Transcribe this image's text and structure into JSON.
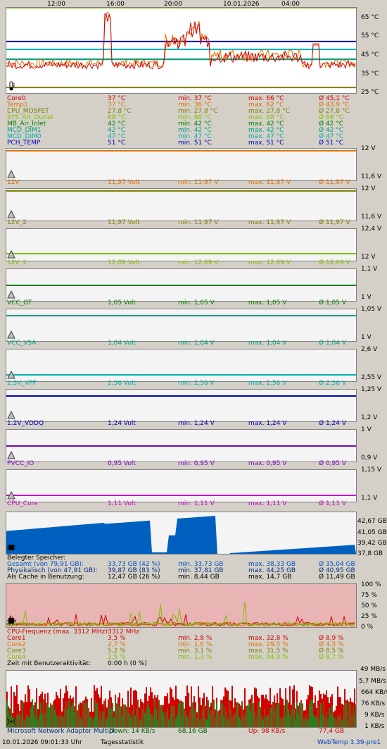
{
  "temp": {
    "x_ticks": [
      "12:00",
      "16:00",
      "20:00",
      "10.01.2026",
      "04:00"
    ],
    "y_ticks": [
      "65 °C",
      "55 °C",
      "45 °C",
      "35 °C",
      "25 °C"
    ],
    "rows": [
      {
        "name": "Core0",
        "cur": "37 °C",
        "min": "min. 37 °C",
        "max": "max. 66 °C",
        "avg": "Ø 45,1 °C",
        "color": "#d40000"
      },
      {
        "name": "Temp1",
        "cur": "37 °C",
        "min": "min. 36 °C",
        "max": "max. 62 °C",
        "avg": "Ø 43,9 °C",
        "color": "#e07000"
      },
      {
        "name": "CPU_MOSFET",
        "cur": "27,8 °C",
        "min": "min. 27,8 °C",
        "max": "max. 27,8 °C",
        "avg": "Ø 27,8 °C",
        "color": "#808000"
      },
      {
        "name": "SYS_Air_Outlet",
        "cur": "68 °C",
        "min": "min. 68 °C",
        "max": "max. 68 °C",
        "avg": "Ø 68 °C",
        "color": "#80c000"
      },
      {
        "name": "MB_Air_Inlet",
        "cur": "42 °C",
        "min": "min. 42 °C",
        "max": "max. 42 °C",
        "avg": "Ø 42 °C",
        "color": "#008000"
      },
      {
        "name": "MCD_DIM1",
        "cur": "42 °C",
        "min": "min. 42 °C",
        "max": "max. 42 °C",
        "avg": "Ø 42 °C",
        "color": "#00a080"
      },
      {
        "name": "MCD_DIM0",
        "cur": "47 °C",
        "min": "min. 47 °C",
        "max": "max. 47 °C",
        "avg": "Ø 47 °C",
        "color": "#00b0b0"
      },
      {
        "name": "PCH_TEMP",
        "cur": "51 °C",
        "min": "min. 51 °C",
        "max": "max. 51 °C",
        "avg": "Ø 51 °C",
        "color": "#0000c0"
      }
    ]
  },
  "volts": [
    {
      "top": "12 V",
      "bottom": "11,6 V",
      "name": "12V",
      "cur": "11,97 Volt",
      "min": "min. 11,97 V",
      "max": "max. 11,97 V",
      "avg": "Ø 11,97 V",
      "color": "#e07000",
      "level": 0.93
    },
    {
      "top": "12 V",
      "bottom": "11,6 V",
      "name": "12V_2",
      "cur": "11,97 Volt",
      "min": "min. 11,97 V",
      "max": "max. 11,97 V",
      "avg": "Ø 11,97 V",
      "color": "#808000",
      "level": 0.93
    },
    {
      "top": "12,4 V",
      "bottom": "12 V",
      "name": "12V_1",
      "cur": "12,09 Volt",
      "min": "min. 12,09 V",
      "max": "max. 12,09 V",
      "avg": "Ø 12,09 V",
      "color": "#80c000",
      "level": 0.22
    },
    {
      "top": "1,1 V",
      "bottom": "1 V",
      "name": "VCC_GT",
      "cur": "1,05 Volt",
      "min": "min. 1,05 V",
      "max": "max. 1,05 V",
      "avg": "Ø 1,05 V",
      "color": "#008000",
      "level": 0.5
    },
    {
      "top": "1,05 V",
      "bottom": "1 V",
      "name": "VCC_VSA",
      "cur": "1,04 Volt",
      "min": "min. 1,04 V",
      "max": "max. 1,04 V",
      "avg": "Ø 1,04 V",
      "color": "#00a080",
      "level": 0.8
    },
    {
      "top": "2,6 V",
      "bottom": "2,55 V",
      "name": "2.5V_VPP",
      "cur": "2,56 Volt",
      "min": "min. 2,56 V",
      "max": "max. 2,56 V",
      "avg": "Ø 2,56 V",
      "color": "#00b0b0",
      "level": 0.2
    },
    {
      "top": "1,25 V",
      "bottom": "1,2 V",
      "name": "1.2V_VDDQ",
      "cur": "1,24 Volt",
      "min": "min. 1,24 V",
      "max": "max. 1,24 V",
      "avg": "Ø 1,24 V",
      "color": "#0000c0",
      "level": 0.8
    },
    {
      "top": "1 V",
      "bottom": "0,9 V",
      "name": "PVCC_IO",
      "cur": "0,95 Volt",
      "min": "min. 0,95 V",
      "max": "max. 0,95 V",
      "avg": "Ø 0,95 V",
      "color": "#8000c0",
      "level": 0.5
    },
    {
      "top": "1,15 V",
      "bottom": "1,1 V",
      "name": "CPU_Core",
      "cur": "1,11 Volt",
      "min": "min. 1,11 V",
      "max": "max. 1,11 V",
      "avg": "Ø 1,11 V",
      "color": "#c000c0",
      "level": 0.2
    }
  ],
  "memory": {
    "y_ticks": [
      "42,67 GB",
      "41,05 GB",
      "39,42 GB",
      "37,8 GB"
    ],
    "header": "Belegter Speicher:",
    "rows": [
      {
        "name": "Gesamt (von 79,91 GB):",
        "cur": "33,73 GB (42 %)",
        "min": "min. 33,73 GB",
        "max": "max. 38,33 GB",
        "avg": "Ø 35,04 GB",
        "color": "#0050c0"
      },
      {
        "name": "Physikalisch (von 47,91 GB):",
        "cur": "39,87 GB (83 %)",
        "min": "min. 37,81 GB",
        "max": "max. 44,25 GB",
        "avg": "Ø 40,95 GB",
        "color": "#003080"
      },
      {
        "name": "Als Cache in Benutzung:",
        "cur": "12,47 GB (26 %)",
        "min": "min. 8,44 GB",
        "max": "max. 14,7 GB",
        "avg": "Ø 11,49 GB",
        "color": "#000000"
      }
    ]
  },
  "cpu": {
    "y_ticks": [
      "100 %",
      "75 %",
      "50 %",
      "25 %",
      "0 %"
    ],
    "freq_label": "CPU-Frequenz (max. 3312 MHz):",
    "freq_value": "3312 MHz",
    "rows": [
      {
        "name": "Core1",
        "cur": "3,5 %",
        "min": "min. 2,8 %",
        "max": "max. 32,8 %",
        "avg": "Ø 8,9 %",
        "color": "#d40000"
      },
      {
        "name": "Core2",
        "cur": "2,7 %",
        "min": "min. 1,6 %",
        "max": "max. 29,5 %",
        "avg": "Ø 4,5 %",
        "color": "#e07000"
      },
      {
        "name": "Core3",
        "cur": "5,2 %",
        "min": "min. 3,1 %",
        "max": "max. 31,5 %",
        "avg": "Ø 8,5 %",
        "color": "#808000"
      },
      {
        "name": "Core4",
        "cur": "2,5 %",
        "min": "min. 1,3 %",
        "max": "max. 64,9 %",
        "avg": "Ø 8,7 %",
        "color": "#80c000"
      }
    ],
    "activity_label": "Zeit mit Benutzeraktivität:",
    "activity_value": "0:00 h (0 %)"
  },
  "network": {
    "y_ticks": [
      "49 MB/s",
      "5,7 MB/s",
      "664 KB/s",
      "76 KB/s",
      "9 KB/s",
      "1 KB/s"
    ],
    "adapter": "Microsoft Network Adapter Multipl",
    "down": "Down: 14 KB/s",
    "down_total": "68,16 GB",
    "up": "Up: 98 KB/s",
    "up_total": "77,4 GB"
  },
  "footer": {
    "timestamp": "10.01.2026 09:01:33 Uhr",
    "stats_link": "Tagesstatistik",
    "version": "WebTemp 3.39-pre1"
  }
}
